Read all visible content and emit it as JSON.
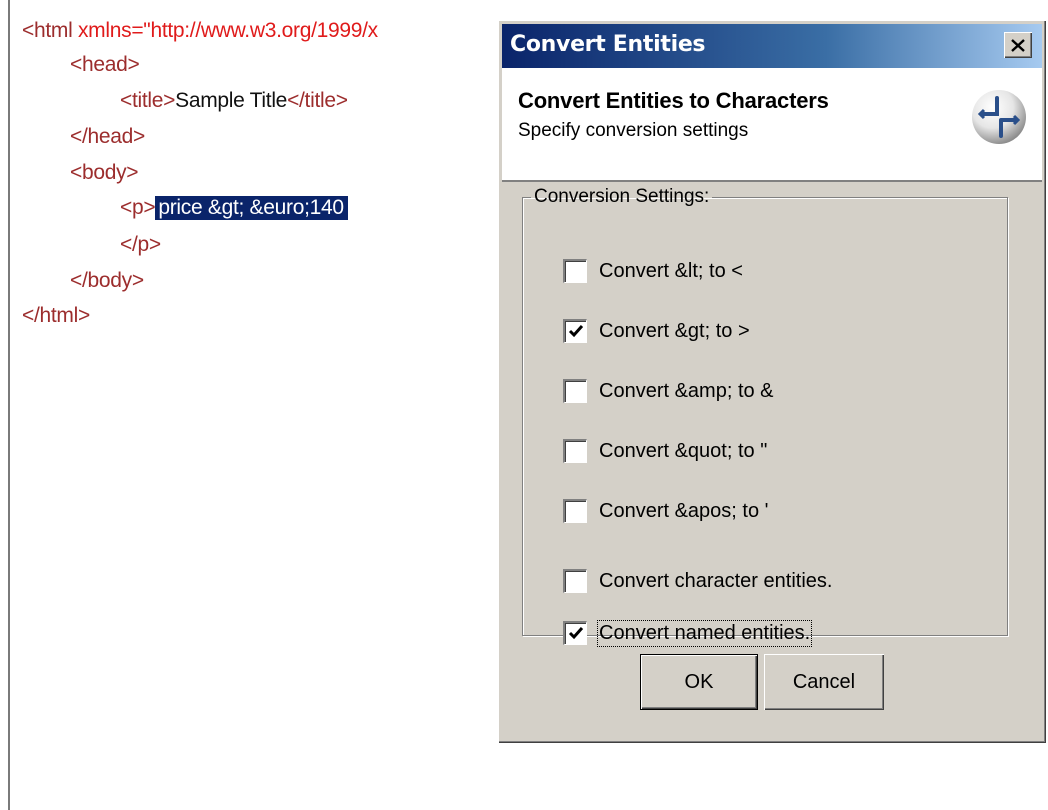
{
  "editor": {
    "line1": {
      "tag_open": "<html ",
      "attr": "xmlns=\"http://www.w3.org/1999/x"
    },
    "head_open": "<head>",
    "title_open": "<title>",
    "title_text": "Sample Title",
    "title_close": "</title>",
    "head_close": "</head>",
    "body_open": "<body>",
    "p_open": "<p>",
    "selected_text": "price &gt; &euro;140",
    "p_close": "</p>",
    "body_close": "</body>",
    "html_close": "</html>"
  },
  "dialog": {
    "title": "Convert Entities",
    "close_label": "×",
    "header_title": "Convert Entities to Characters",
    "header_subtitle": "Specify conversion settings",
    "icon": "convert-arrows-icon",
    "group_label": "Conversion Settings:",
    "options": [
      {
        "label": "Convert &lt; to <",
        "checked": false
      },
      {
        "label": "Convert &gt; to >",
        "checked": true
      },
      {
        "label": "Convert &amp; to &",
        "checked": false
      },
      {
        "label": "Convert &quot; to \"",
        "checked": false
      },
      {
        "label": "Convert &apos; to '",
        "checked": false
      },
      {
        "label": "Convert character entities.",
        "checked": false
      },
      {
        "label": "Convert named entities.",
        "checked": true
      }
    ],
    "ok_label": "OK",
    "cancel_label": "Cancel"
  },
  "colors": {
    "tag": "#9c2d2d",
    "attribute": "#e01b1b",
    "selection": "#0a246a",
    "dialog_face": "#d4d0c8"
  }
}
